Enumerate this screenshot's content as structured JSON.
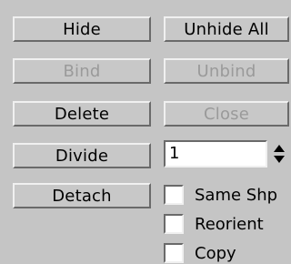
{
  "buttons": {
    "hide": "Hide",
    "unhide_all": "Unhide All",
    "bind": "Bind",
    "unbind": "Unbind",
    "delete": "Delete",
    "close": "Close",
    "divide": "Divide",
    "detach": "Detach"
  },
  "divide_spinner": {
    "value": "1"
  },
  "checkboxes": {
    "same_shp": {
      "label": "Same Shp",
      "checked": false
    },
    "reorient": {
      "label": "Reorient",
      "checked": false
    },
    "copy": {
      "label": "Copy",
      "checked": false
    }
  },
  "colors": {
    "panel_bg": "#c5c5c5",
    "disabled_text": "#9a9a9a"
  }
}
